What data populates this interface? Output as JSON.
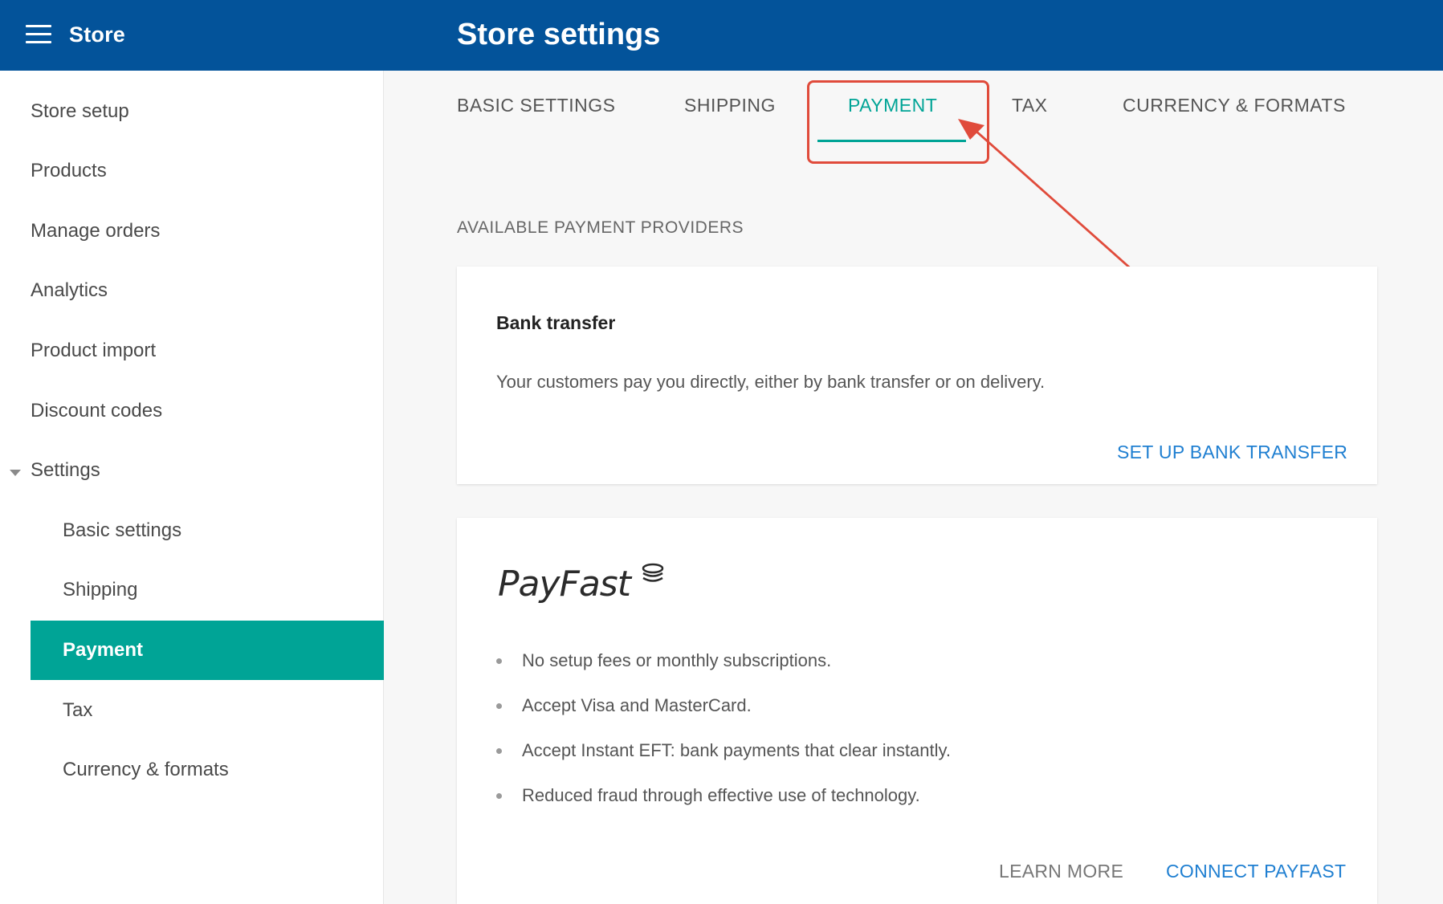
{
  "header": {
    "app_title": "Store",
    "page_title": "Store settings"
  },
  "sidebar": {
    "items": [
      {
        "label": "Store setup"
      },
      {
        "label": "Products"
      },
      {
        "label": "Manage orders"
      },
      {
        "label": "Analytics"
      },
      {
        "label": "Product import"
      },
      {
        "label": "Discount codes"
      },
      {
        "label": "Settings"
      }
    ],
    "sub_items": [
      {
        "label": "Basic settings"
      },
      {
        "label": "Shipping"
      },
      {
        "label": "Payment",
        "active": true
      },
      {
        "label": "Tax"
      },
      {
        "label": "Currency & formats"
      }
    ]
  },
  "tabs": [
    {
      "label": "BASIC SETTINGS"
    },
    {
      "label": "SHIPPING"
    },
    {
      "label": "PAYMENT",
      "active": true
    },
    {
      "label": "TAX"
    },
    {
      "label": "CURRENCY & FORMATS"
    }
  ],
  "main": {
    "section_label": "AVAILABLE PAYMENT PROVIDERS",
    "bank_transfer": {
      "title": "Bank transfer",
      "description": "Your customers pay you directly, either by bank transfer or on delivery.",
      "action": "SET UP BANK TRANSFER"
    },
    "payfast": {
      "logo_text": "PayFast",
      "bullets": [
        "No setup fees or monthly subscriptions.",
        "Accept Visa and MasterCard.",
        "Accept Instant EFT: bank payments that clear instantly.",
        "Reduced fraud through effective use of technology."
      ],
      "learn_more": "LEARN MORE",
      "connect": "CONNECT PAYFAST"
    }
  },
  "colors": {
    "header_bg": "#03539a",
    "accent": "#00a496",
    "link": "#1f7fd1",
    "annotation": "#e04b3b"
  }
}
